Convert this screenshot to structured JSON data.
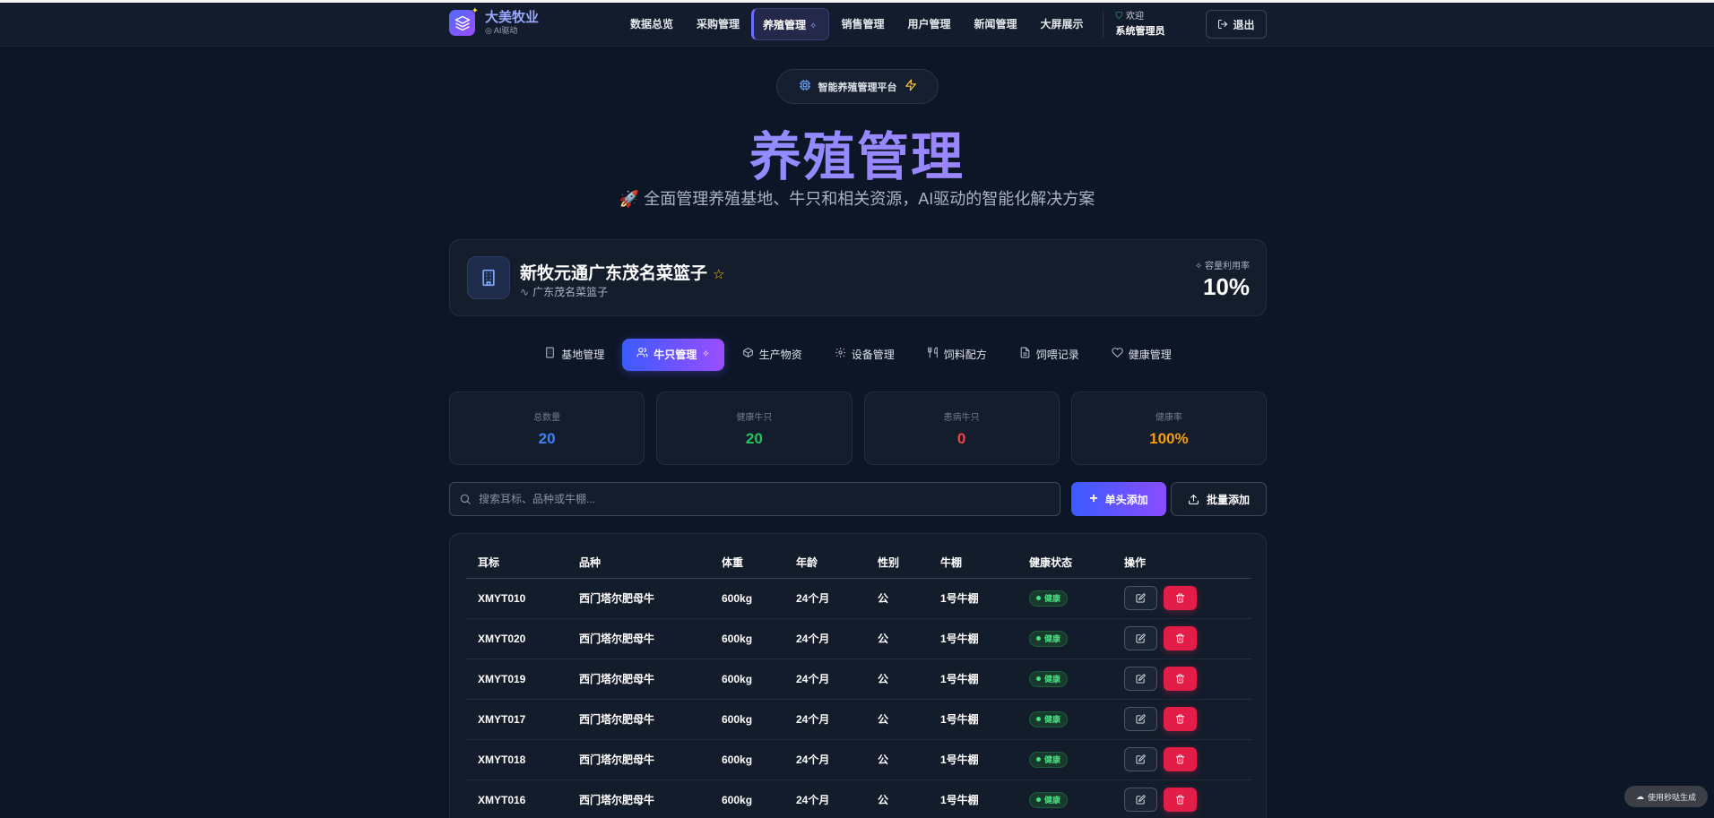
{
  "header": {
    "brand_title": "大美牧业",
    "brand_sub": "AI驱动",
    "nav": [
      {
        "label": "数据总览"
      },
      {
        "label": "采购管理"
      },
      {
        "label": "养殖管理",
        "active": true
      },
      {
        "label": "销售管理"
      },
      {
        "label": "用户管理"
      },
      {
        "label": "新闻管理"
      },
      {
        "label": "大屏展示"
      }
    ],
    "user_greet": "欢迎",
    "user_name": "系统管理员",
    "logout": "退出"
  },
  "hero": {
    "badge": "智能养殖管理平台",
    "title": "养殖管理",
    "subtitle": "🚀 全面管理养殖基地、牛只和相关资源，AI驱动的智能化解决方案"
  },
  "base": {
    "name": "新牧元通广东茂名菜篮子",
    "location": "广东茂名菜篮子",
    "capacity_label": "容量利用率",
    "capacity_value": "10%"
  },
  "tabs": [
    {
      "label": "基地管理",
      "icon": "building-icon"
    },
    {
      "label": "牛只管理",
      "icon": "users-icon",
      "active": true
    },
    {
      "label": "生产物资",
      "icon": "box-icon"
    },
    {
      "label": "设备管理",
      "icon": "gear-icon"
    },
    {
      "label": "饲料配方",
      "icon": "utensils-icon"
    },
    {
      "label": "饲喂记录",
      "icon": "document-icon"
    },
    {
      "label": "健康管理",
      "icon": "heart-icon"
    }
  ],
  "stats": [
    {
      "label": "总数量",
      "value": "20",
      "color": "#3b82f6"
    },
    {
      "label": "健康牛只",
      "value": "20",
      "color": "#22c55e"
    },
    {
      "label": "患病牛只",
      "value": "0",
      "color": "#ef4444"
    },
    {
      "label": "健康率",
      "value": "100%",
      "color": "#f59e0b"
    }
  ],
  "search": {
    "placeholder": "搜索耳标、品种或牛棚..."
  },
  "actions": {
    "add": "单头添加",
    "bulk": "批量添加"
  },
  "table": {
    "headers": [
      "耳标",
      "品种",
      "体重",
      "年龄",
      "性别",
      "牛棚",
      "健康状态",
      "操作"
    ],
    "rows": [
      {
        "tag": "XMYT010",
        "breed": "西门塔尔肥母牛",
        "weight": "600kg",
        "age": "24个月",
        "sex": "公",
        "barn": "1号牛棚",
        "status": "健康"
      },
      {
        "tag": "XMYT020",
        "breed": "西门塔尔肥母牛",
        "weight": "600kg",
        "age": "24个月",
        "sex": "公",
        "barn": "1号牛棚",
        "status": "健康"
      },
      {
        "tag": "XMYT019",
        "breed": "西门塔尔肥母牛",
        "weight": "600kg",
        "age": "24个月",
        "sex": "公",
        "barn": "1号牛棚",
        "status": "健康"
      },
      {
        "tag": "XMYT017",
        "breed": "西门塔尔肥母牛",
        "weight": "600kg",
        "age": "24个月",
        "sex": "公",
        "barn": "1号牛棚",
        "status": "健康"
      },
      {
        "tag": "XMYT018",
        "breed": "西门塔尔肥母牛",
        "weight": "600kg",
        "age": "24个月",
        "sex": "公",
        "barn": "1号牛棚",
        "status": "健康"
      },
      {
        "tag": "XMYT016",
        "breed": "西门塔尔肥母牛",
        "weight": "600kg",
        "age": "24个月",
        "sex": "公",
        "barn": "1号牛棚",
        "status": "健康"
      }
    ]
  },
  "watermark": "使用秒哒生成"
}
